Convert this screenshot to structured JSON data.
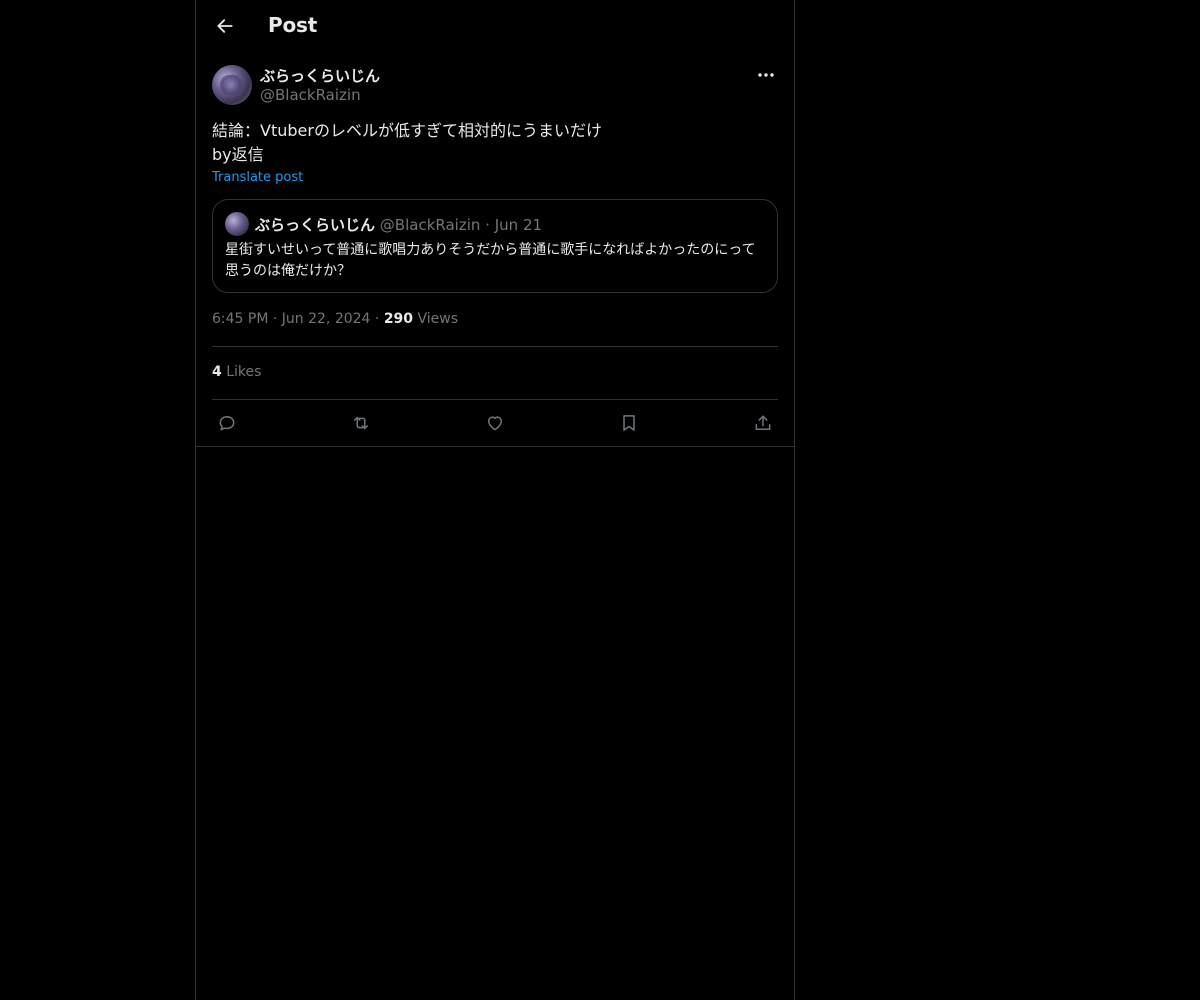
{
  "header": {
    "title": "Post",
    "back_icon": "arrow-left-icon"
  },
  "post": {
    "author": {
      "display_name": "ぶらっくらいじん",
      "handle": "@BlackRaizin"
    },
    "more_icon": "more-horizontal-icon",
    "text": "結論：Vtuberのレベルが低すぎて相対的にうまいだけ\nby返信",
    "translate_label": "Translate post",
    "quote": {
      "display_name": "ぶらっくらいじん",
      "handle": "@BlackRaizin",
      "separator": "·",
      "date": "Jun 21",
      "text": "星街すいせいって普通に歌唱力ありそうだから普通に歌手になればよかったのにって思うのは俺だけか？"
    },
    "meta": {
      "time": "6:45 PM",
      "separator": "·",
      "date": "Jun 22, 2024",
      "views_count": "290",
      "views_label": "Views"
    },
    "likes": {
      "count": "4",
      "label": "Likes"
    },
    "actions": [
      {
        "name": "reply",
        "icon": "reply-icon"
      },
      {
        "name": "repost",
        "icon": "repost-icon"
      },
      {
        "name": "like",
        "icon": "heart-icon"
      },
      {
        "name": "bookmark",
        "icon": "bookmark-icon"
      },
      {
        "name": "share",
        "icon": "share-icon"
      }
    ]
  },
  "colors": {
    "background": "#000000",
    "text_primary": "#e7e9ea",
    "text_secondary": "#71767b",
    "border": "#2f3336",
    "link": "#1d9bf0"
  }
}
